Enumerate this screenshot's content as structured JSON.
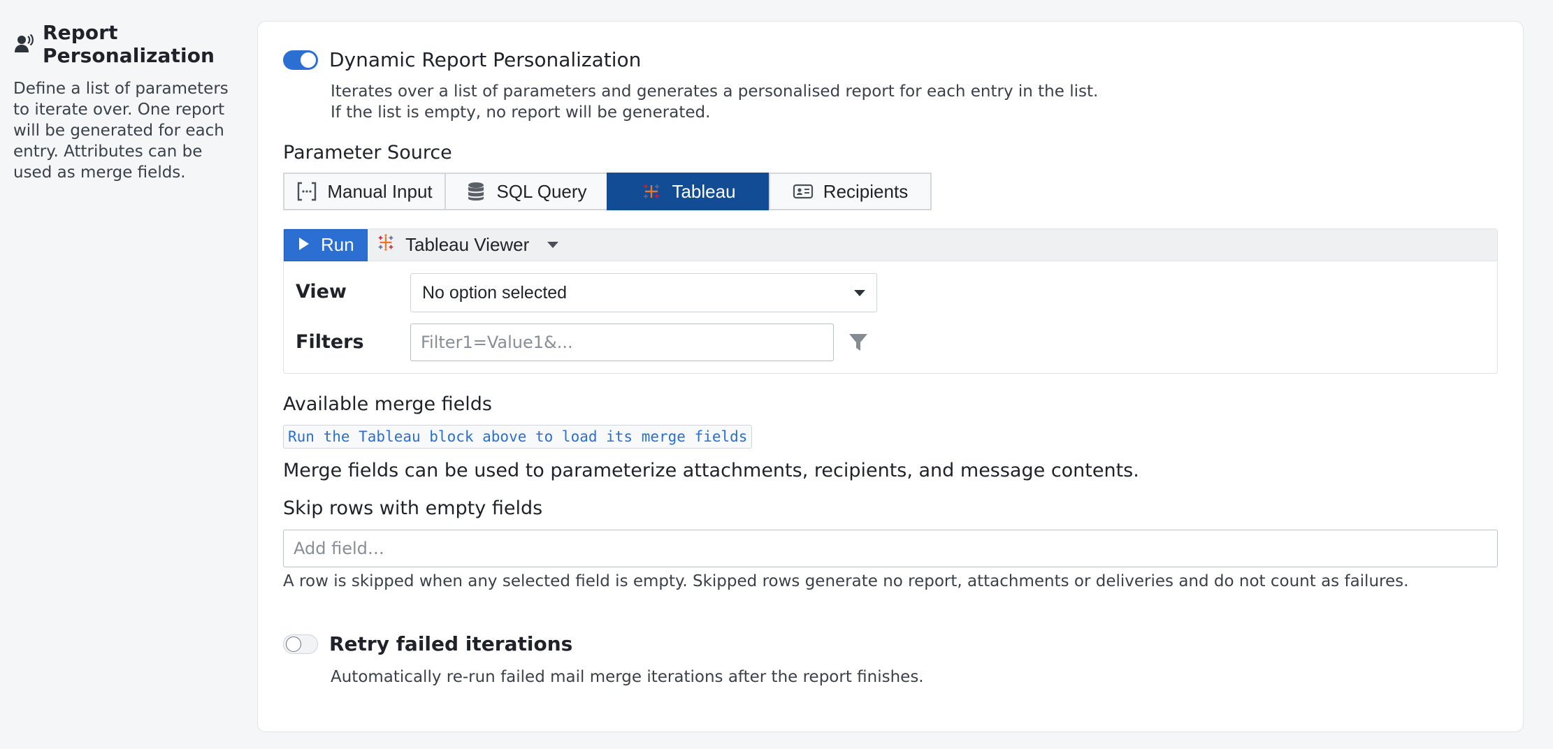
{
  "sidebar": {
    "icon": "user-voice-icon",
    "title": "Report Personalization",
    "description": "Define a list of parameters to iterate over. One report will be generated for each entry. Attributes can be used as merge fields."
  },
  "dynamic": {
    "enabled": true,
    "label": "Dynamic Report Personalization",
    "help_line1": "Iterates over a list of parameters and generates a personalised report for each entry in the list.",
    "help_line2": "If the list is empty, no report will be generated."
  },
  "parameter_source": {
    "label": "Parameter Source",
    "options": [
      {
        "label": "Manual Input",
        "icon": "brackets-icon"
      },
      {
        "label": "SQL Query",
        "icon": "database-icon"
      },
      {
        "label": "Tableau",
        "icon": "tableau-icon"
      },
      {
        "label": "Recipients",
        "icon": "id-card-icon"
      }
    ],
    "selected": "Tableau"
  },
  "tableau_block": {
    "run_label": "Run",
    "source_label": "Tableau Viewer",
    "view_label": "View",
    "view_value": "No option selected",
    "filters_label": "Filters",
    "filters_placeholder": "Filter1=Value1&..."
  },
  "merge_fields": {
    "label": "Available merge fields",
    "hint": "Run the Tableau block above to load its merge fields",
    "note": "Merge fields can be used to parameterize attachments, recipients, and message contents."
  },
  "skip_rows": {
    "label": "Skip rows with empty fields",
    "placeholder": "Add field…",
    "help": "A row is skipped when any selected field is empty. Skipped rows generate no report, attachments or deliveries and do not count as failures."
  },
  "retry": {
    "enabled": false,
    "label": "Retry failed iterations",
    "help": "Automatically re-run failed mail merge iterations after the report finishes."
  },
  "colors": {
    "accent": "#2a6fd1",
    "selected_segment": "#124c94"
  }
}
